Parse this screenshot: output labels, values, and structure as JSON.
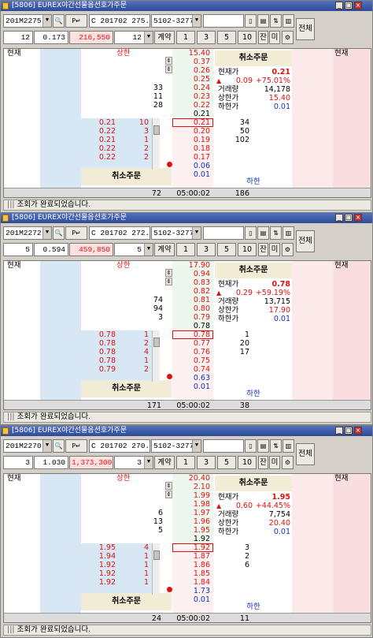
{
  "title_prefix": "[5806]",
  "title_name": "EUREX야간선물옵션호가주문",
  "panels": [
    {
      "code": "201M2275",
      "option_code": "C 201702 275.",
      "account": "5102-3277",
      "qty": "12",
      "delta": "0.173",
      "amount": "216,550",
      "order_qty": "12",
      "upper": "상한",
      "lower": "하한",
      "ask_prices": [
        "15.40",
        "0.37",
        "0.26",
        "0.25",
        "0.24",
        "0.23",
        "0.22",
        "0.21"
      ],
      "ask_qtys": [
        "",
        "",
        "",
        "",
        "33",
        "11",
        "28",
        ""
      ],
      "bid_prices": [
        "0.21",
        "0.20",
        "0.19",
        "0.18",
        "0.17",
        "0.06",
        "0.01"
      ],
      "bid_qtys": [
        "34",
        "50",
        "102",
        "",
        "",
        "",
        ""
      ],
      "bid_left": [
        [
          "0.21",
          "10"
        ],
        [
          "0.22",
          "3"
        ],
        [
          "0.21",
          "1"
        ],
        [
          "0.22",
          "2"
        ],
        [
          "0.22",
          "2"
        ]
      ],
      "cur": "0.21",
      "chg": "0.09",
      "pct": "+75.01%",
      "vol": "14,178",
      "hi": "15.40",
      "lo": "0.01",
      "total_ask": "72",
      "time": "05:00:02",
      "total_bid": "186"
    },
    {
      "code": "201M2272",
      "option_code": "C 201702 272.",
      "account": "5102-3277",
      "qty": "5",
      "delta": "0.594",
      "amount": "459,850",
      "order_qty": "5",
      "upper": "상한",
      "lower": "하한",
      "ask_prices": [
        "17.90",
        "0.94",
        "0.83",
        "0.82",
        "0.81",
        "0.80",
        "0.79",
        "0.78"
      ],
      "ask_qtys": [
        "",
        "",
        "",
        "",
        "74",
        "94",
        "3",
        ""
      ],
      "bid_prices": [
        "0.78",
        "0.77",
        "0.76",
        "0.75",
        "0.74",
        "0.63",
        "0.01"
      ],
      "bid_qtys": [
        "1",
        "20",
        "17",
        "",
        "",
        "",
        ""
      ],
      "bid_left": [
        [
          "0.78",
          "1"
        ],
        [
          "0.78",
          "2"
        ],
        [
          "0.78",
          "4"
        ],
        [
          "0.78",
          "1"
        ],
        [
          "0.79",
          "2"
        ]
      ],
      "cur": "0.78",
      "chg": "0.29",
      "pct": "+59.19%",
      "vol": "13,715",
      "hi": "17.90",
      "lo": "0.01",
      "total_ask": "171",
      "time": "05:00:02",
      "total_bid": "38"
    },
    {
      "code": "201M2270",
      "option_code": "C 201702 270.",
      "account": "5102-3277",
      "qty": "3",
      "delta": "1.030",
      "amount": "1,373,300",
      "order_qty": "3",
      "upper": "상한",
      "lower": "하한",
      "ask_prices": [
        "20.40",
        "2.10",
        "1.99",
        "1.98",
        "1.97",
        "1.96",
        "1.95",
        "1.92"
      ],
      "ask_qtys": [
        "",
        "",
        "",
        "",
        "6",
        "13",
        "5",
        ""
      ],
      "bid_prices": [
        "1.92",
        "1.87",
        "1.86",
        "1.85",
        "1.84",
        "1.73",
        "0.01"
      ],
      "bid_qtys": [
        "3",
        "2",
        "6",
        "",
        "",
        "",
        ""
      ],
      "bid_left": [
        [
          "1.95",
          "4"
        ],
        [
          "1.94",
          "1"
        ],
        [
          "1.92",
          "1"
        ],
        [
          "1.92",
          "1"
        ],
        [
          "1.92",
          "1"
        ]
      ],
      "cur": "1.95",
      "chg": "0.60",
      "pct": "+44.45%",
      "vol": "7,754",
      "hi": "20.40",
      "lo": "0.01",
      "total_ask": "24",
      "time": "05:00:02",
      "total_bid": "11"
    }
  ],
  "labels": {
    "current": "현재",
    "cancel": "취소주문",
    "cur_price": "현재가",
    "volume": "거래량",
    "hi": "상한가",
    "lo": "하한가",
    "order_type": "계약",
    "all": "전체",
    "status": "조회가 완료되었습니다.",
    "jan": "잔",
    "mi": "미",
    "qb1": "1",
    "qb2": "3",
    "qb3": "5",
    "qb4": "10"
  },
  "colors": {
    "up": "#e01010",
    "ask_bg": "#d7e7f4",
    "bid_bg": "#f8dede"
  }
}
